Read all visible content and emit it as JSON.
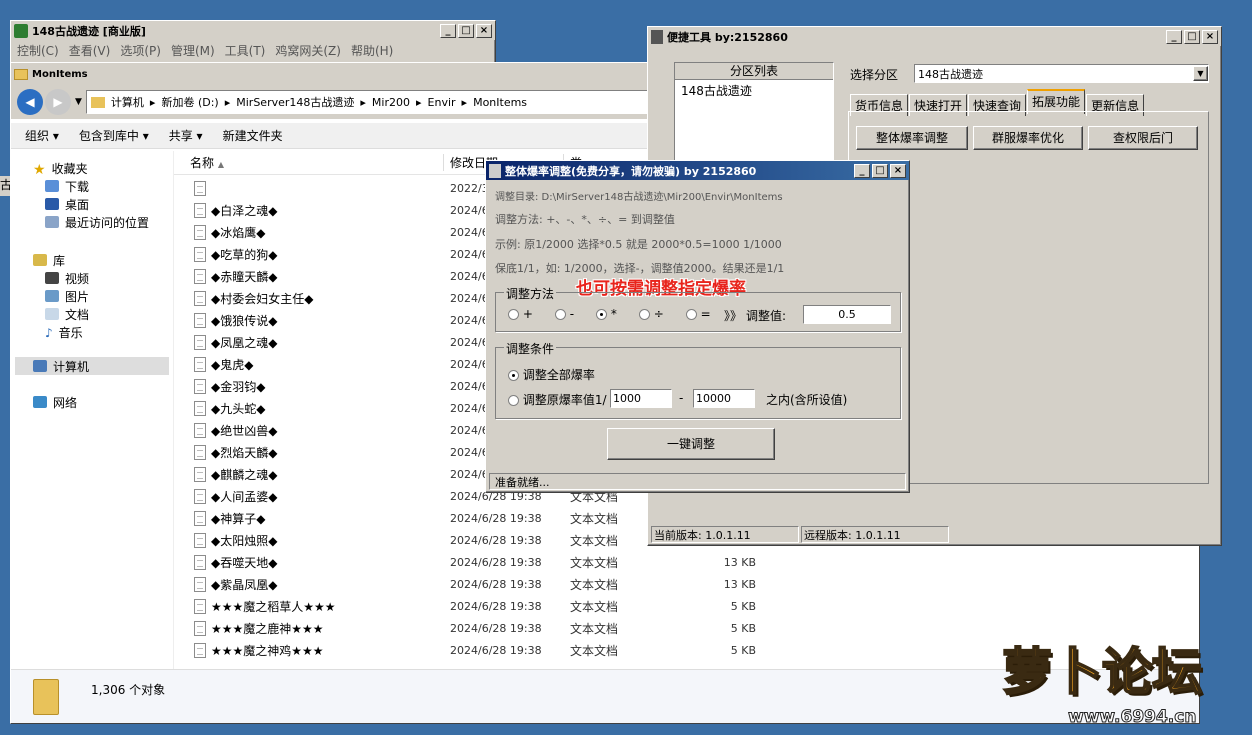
{
  "back_window": {
    "title": "148古战遗迹 [商业版]",
    "menu": [
      "控制(C)",
      "查看(V)",
      "选项(P)",
      "管理(M)",
      "工具(T)",
      "鸡窝网关(Z)",
      "帮助(H)"
    ],
    "side_text": "古"
  },
  "explorer": {
    "title": "MonItems",
    "address": [
      "计算机",
      "新加卷 (D:)",
      "MirServer148古战遗迹",
      "Mir200",
      "Envir",
      "MonItems"
    ],
    "toolbar": {
      "organize": "组织",
      "include": "包含到库中",
      "share": "共享",
      "new_folder": "新建文件夹"
    },
    "nav": {
      "favorites": "收藏夹",
      "favorites_items": [
        "下载",
        "桌面",
        "最近访问的位置"
      ],
      "library": "库",
      "library_items": [
        "视频",
        "图片",
        "文档",
        "音乐"
      ],
      "computer": "计算机",
      "network": "网络"
    },
    "columns": {
      "name": "名称",
      "date": "修改日期",
      "type": "类"
    },
    "files": [
      {
        "name": "",
        "date": "2022/3",
        "type": "",
        "size": ""
      },
      {
        "name": "◆白泽之魂◆",
        "date": "2024/6",
        "type": "",
        "size": ""
      },
      {
        "name": "◆冰焰鹰◆",
        "date": "2024/6",
        "type": "",
        "size": ""
      },
      {
        "name": "◆吃草的狗◆",
        "date": "2024/6",
        "type": "",
        "size": ""
      },
      {
        "name": "◆赤瞳天麟◆",
        "date": "2024/6",
        "type": "",
        "size": ""
      },
      {
        "name": "◆村委会妇女主任◆",
        "date": "2024/6",
        "type": "",
        "size": ""
      },
      {
        "name": "◆饿狼传说◆",
        "date": "2024/6",
        "type": "",
        "size": ""
      },
      {
        "name": "◆凤凰之魂◆",
        "date": "2024/6",
        "type": "",
        "size": ""
      },
      {
        "name": "◆鬼虎◆",
        "date": "2024/6",
        "type": "",
        "size": ""
      },
      {
        "name": "◆金羽钧◆",
        "date": "2024/6",
        "type": "",
        "size": ""
      },
      {
        "name": "◆九头蛇◆",
        "date": "2024/6",
        "type": "",
        "size": ""
      },
      {
        "name": "◆绝世凶兽◆",
        "date": "2024/6",
        "type": "",
        "size": ""
      },
      {
        "name": "◆烈焰天麟◆",
        "date": "2024/6",
        "type": "",
        "size": ""
      },
      {
        "name": "◆麒麟之魂◆",
        "date": "2024/6",
        "type": "",
        "size": ""
      },
      {
        "name": "◆人间孟婆◆",
        "date": "2024/6/28 19:38",
        "type": "文本文档",
        "size": ""
      },
      {
        "name": "◆神算子◆",
        "date": "2024/6/28 19:38",
        "type": "文本文档",
        "size": ""
      },
      {
        "name": "◆太阳烛照◆",
        "date": "2024/6/28 19:38",
        "type": "文本文档",
        "size": ""
      },
      {
        "name": "◆吞噬天地◆",
        "date": "2024/6/28 19:38",
        "type": "文本文档",
        "size": "13 KB"
      },
      {
        "name": "◆紫晶凤凰◆",
        "date": "2024/6/28 19:38",
        "type": "文本文档",
        "size": "13 KB"
      },
      {
        "name": "★★★魔之稻草人★★★",
        "date": "2024/6/28 19:38",
        "type": "文本文档",
        "size": "5 KB"
      },
      {
        "name": "★★★魔之鹿神★★★",
        "date": "2024/6/28 19:38",
        "type": "文本文档",
        "size": "5 KB"
      },
      {
        "name": "★★★魔之神鸡★★★",
        "date": "2024/6/28 19:38",
        "type": "文本文档",
        "size": "5 KB"
      }
    ],
    "status": "1,306 个对象"
  },
  "tools": {
    "title": "便捷工具   by:2152860",
    "partition_header": "分区列表",
    "partition_items": [
      "148古战遗迹"
    ],
    "select_label": "选择分区",
    "select_value": "148古战遗迹",
    "tabs": [
      "货币信息",
      "快速打开",
      "快速查询",
      "拓展功能",
      "更新信息"
    ],
    "buttons": [
      "整体爆率调整",
      "群服爆率优化",
      "查权限后门"
    ],
    "version_local": "当前版本: 1.0.1.11",
    "version_remote": "远程版本: 1.0.1.11"
  },
  "dialog": {
    "title": "整体爆率调整(免费分享，请勿被骗)   by 2152860",
    "dir": "调整目录: D:\\MirServer148古战遗迹\\Mir200\\Envir\\MonItems",
    "method_hint": "调整方法: +、-、*、÷、=  到调整值",
    "example": "示例: 原1/2000 选择*0.5 就是 2000*0.5=1000  1/1000",
    "floor": "保底1/1，如: 1/2000，选择-，调整值2000。结果还是1/1",
    "overlay": "也可按需调整指定爆率",
    "method_group": "调整方法",
    "ops": [
      "+",
      "-",
      "*",
      "÷",
      "="
    ],
    "selected_op": "*",
    "arrows": "》》",
    "value_label": "调整值:",
    "value": "0.5",
    "cond_group": "调整条件",
    "cond_all": "调整全部爆率",
    "cond_range": "调整原爆率值1/",
    "range_from": "1000",
    "range_dash": "-",
    "range_to": "10000",
    "range_suffix": "之内(含所设值)",
    "run_button": "一键调整",
    "status": "准备就绪..."
  },
  "watermark": {
    "logo": "萝卜论坛",
    "url": "www.6994.cn"
  },
  "colors": {
    "desktop": "#3a6ea5",
    "title_active": "#0a246a",
    "overlay_red": "#e8241c",
    "tab_accent": "#f0a000"
  }
}
